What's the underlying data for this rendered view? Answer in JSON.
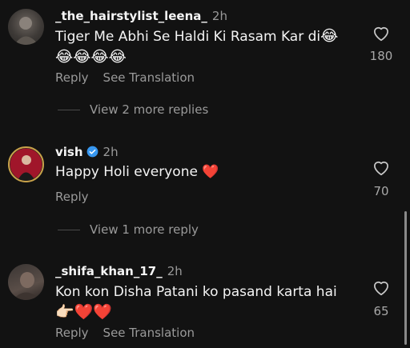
{
  "colors": {
    "background": "#121212",
    "heart": "#e0192c",
    "verified": "#3797f0",
    "muted": "#9a9a9a"
  },
  "comments": [
    {
      "username": "_the_hairstylist_leena_",
      "time": "2h",
      "line1": "Tiger Me Abhi Se Haldi Ki Rasam Kar di",
      "line1_emoji": "😂",
      "line2": "😂😂😂😂",
      "actions": [
        "Reply",
        "See Translation"
      ],
      "likes": "180",
      "replies_link": "View 2 more replies"
    },
    {
      "username": "vish",
      "verified": true,
      "time": "2h",
      "line1": "Happy Holi everyone",
      "line1_emoji": "❤️",
      "actions": [
        "Reply"
      ],
      "likes": "70",
      "replies_link": "View 1 more reply"
    },
    {
      "username": "_shifa_khan_17_",
      "time": "2h",
      "line1": "Kon kon Disha Patani ko pasand karta hai",
      "line2": "👉🏻❤️❤️",
      "actions": [
        "Reply",
        "See Translation"
      ],
      "likes": "65"
    }
  ]
}
